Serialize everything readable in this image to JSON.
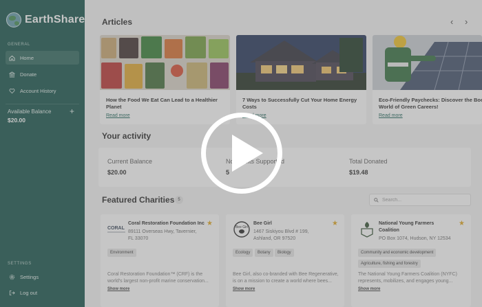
{
  "sidebar": {
    "brand": "EarthShare",
    "general_label": "GENERAL",
    "items": [
      {
        "label": "Home",
        "icon": "home-icon"
      },
      {
        "label": "Donate",
        "icon": "bank-icon"
      },
      {
        "label": "Account History",
        "icon": "heart-icon"
      }
    ],
    "balance_label": "Available Balance",
    "balance_value": "$20.00",
    "settings_label": "SETTINGS",
    "settings_items": [
      {
        "label": "Settings",
        "icon": "gear-icon"
      },
      {
        "label": "Log out",
        "icon": "logout-icon"
      }
    ]
  },
  "articles": {
    "title": "Articles",
    "items": [
      {
        "title": "How the Food We Eat Can Lead to a Healthier Planet",
        "link": "Read more"
      },
      {
        "title": "7 Ways to Successfully Cut Your Home Energy Costs",
        "link": "Read more"
      },
      {
        "title": "Eco-Friendly Paychecks: Discover the Booming World of Green Careers!",
        "link": "Read more"
      }
    ]
  },
  "activity": {
    "title": "Your activity",
    "current_balance_label": "Current Balance",
    "current_balance": "$20.00",
    "nonprofits_label": "Nonprofits Supported",
    "nonprofits_value": "5",
    "donated_label": "Total Donated",
    "donated_value": "$19.48"
  },
  "charities": {
    "title": "Featured Charities",
    "count": "5",
    "search_placeholder": "Search...",
    "items": [
      {
        "name": "Coral Restoration Foundation Inc",
        "addr1": "89111 Overseas Hwy, Tavernier,",
        "addr2": "FL 33070",
        "tags": [
          "Environment"
        ],
        "desc": "Coral Restoration Foundation™ (CRF) is the world's largest non-profit marine conservation...",
        "more": "Show more",
        "logo_text": "CORAL"
      },
      {
        "name": "Bee Girl",
        "addr1": "1467 Siskiyou Blvd # 199,",
        "addr2": "Ashland, OR 97520",
        "tags": [
          "Ecology",
          "Botany",
          "Biology"
        ],
        "desc": "Bee Girl, also co-branded with Bee Regenerative, is on a mission to create a world where bees...",
        "more": "Show more",
        "logo_text": "Bee Girl"
      },
      {
        "name": "National Young Farmers Coalition",
        "addr1": "PO Box 1074, Hudson, NY 12534",
        "addr2": "",
        "tags": [
          "Community and economic development",
          "Agriculture, fishing and forestry"
        ],
        "desc": "The National Young Farmers Coalition (NYFC) represents, mobilizes, and engages young...",
        "more": "Show more",
        "logo_text": ""
      }
    ]
  },
  "colors": {
    "sidebar": "#0e4f45",
    "accent": "#0e5a4e",
    "star": "#e0a418"
  }
}
